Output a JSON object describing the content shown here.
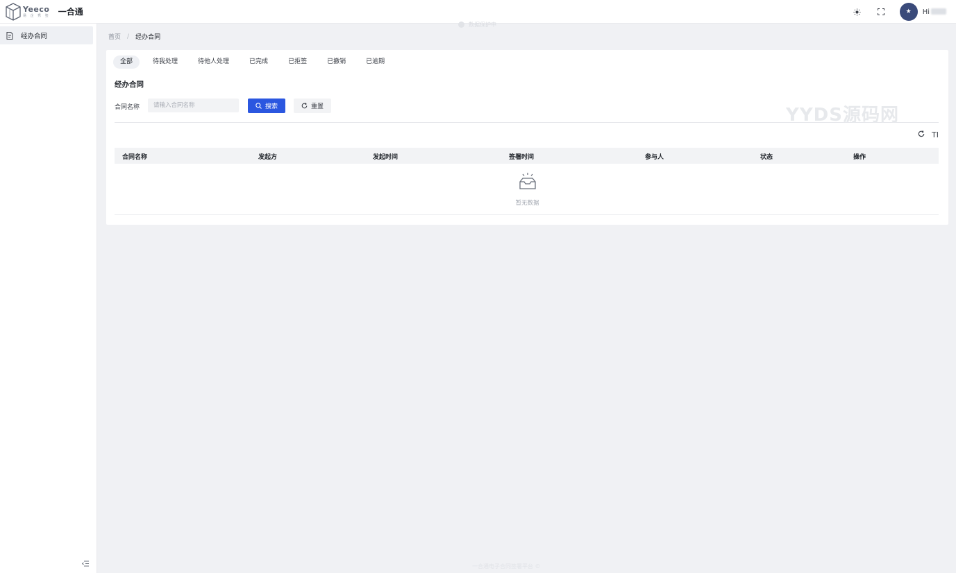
{
  "header": {
    "logo_brand": "Yeeco",
    "logo_sub": "易 企 秀 签",
    "app_title": "一合通",
    "watermark": "数据保护中",
    "greeting": "Hi",
    "avatar_glyph": "★",
    "icons": [
      "theme-icon",
      "fullscreen-icon"
    ]
  },
  "sidebar": {
    "items": [
      {
        "label": "经办合同",
        "icon": "document-icon",
        "active": true
      }
    ],
    "collapse_icon": "menu-fold-icon"
  },
  "breadcrumb": {
    "root": "首页",
    "separator": "/",
    "current": "经办合同"
  },
  "tabs": [
    {
      "label": "全部",
      "active": true
    },
    {
      "label": "待我处理",
      "active": false
    },
    {
      "label": "待他人处理",
      "active": false
    },
    {
      "label": "已完成",
      "active": false
    },
    {
      "label": "已拒签",
      "active": false
    },
    {
      "label": "已撤销",
      "active": false
    },
    {
      "label": "已逾期",
      "active": false
    }
  ],
  "section_title": "经办合同",
  "filter": {
    "label": "合同名称",
    "placeholder": "请输入合同名称",
    "value": "",
    "search_label": "搜索",
    "reset_label": "重置"
  },
  "table": {
    "columns": [
      "合同名称",
      "发起方",
      "发起时间",
      "签署时间",
      "参与人",
      "状态",
      "操作"
    ],
    "rows": [],
    "empty_text": "暂无数据",
    "density_label": "TI"
  },
  "watermark_big": "YYDS源码网",
  "footer": "一合通电子合同签署平台 ©",
  "colors": {
    "primary": "#2b57e0",
    "page_bg": "#f0f1f4",
    "avatar_bg": "#3a4a7a"
  }
}
